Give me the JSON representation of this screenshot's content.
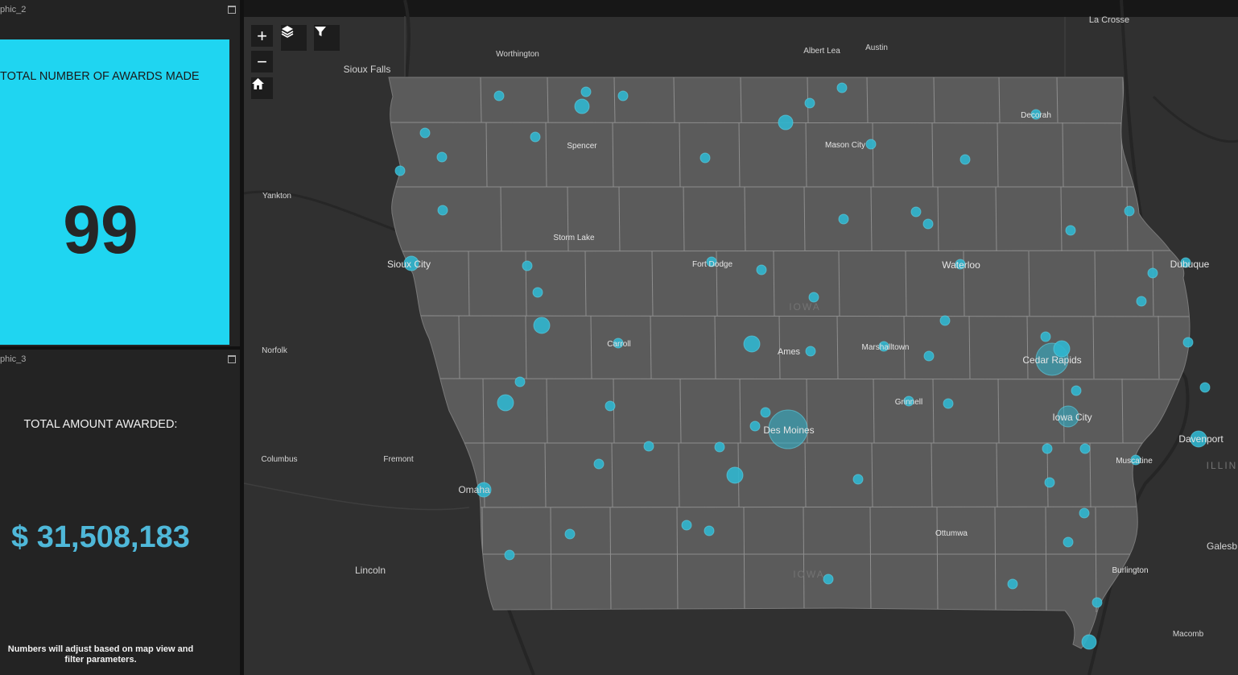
{
  "panels": {
    "awards": {
      "title": "phic_2",
      "label": "TOTAL NUMBER OF AWARDS MADE",
      "value": "99",
      "tile_color": "#1fd5f1"
    },
    "amount": {
      "title": "phic_3",
      "label": "TOTAL AMOUNT AWARDED:",
      "value": "$ 31,508,183",
      "note": "Numbers will adjust based on map view and filter parameters.",
      "value_color": "#4fb8d9"
    }
  },
  "map": {
    "controls": {
      "zoom_in": "+",
      "zoom_out": "−",
      "home_icon": "home-icon",
      "layers_icon": "layers-icon",
      "filter_icon": "filter-icon"
    },
    "state_labels": [
      "IOWA",
      "IOWA",
      "ILLIN"
    ],
    "cities_outside": [
      "La Crosse",
      "Worthington",
      "Albert Lea",
      "Austin",
      "Sioux Falls",
      "Yankton",
      "Norfolk",
      "Columbus",
      "Fremont",
      "Omaha",
      "Lincoln",
      "Galesb",
      "Macomb"
    ],
    "cities_inside": [
      "Spencer",
      "Mason City",
      "Decorah",
      "Storm Lake",
      "Sioux City",
      "Fort Dodge",
      "Waterloo",
      "Dubuque",
      "Carroll",
      "Ames",
      "Marshalltown",
      "Cedar Rapids",
      "Grinnell",
      "Iowa City",
      "Des Moines",
      "Davenport",
      "Muscatine",
      "Ottumwa",
      "Burlington"
    ],
    "colors": {
      "background": "#303030",
      "state_fill": "#5b5b5b",
      "county_lines": "#8c8c8c",
      "point_fill": "#30b6cf"
    }
  }
}
